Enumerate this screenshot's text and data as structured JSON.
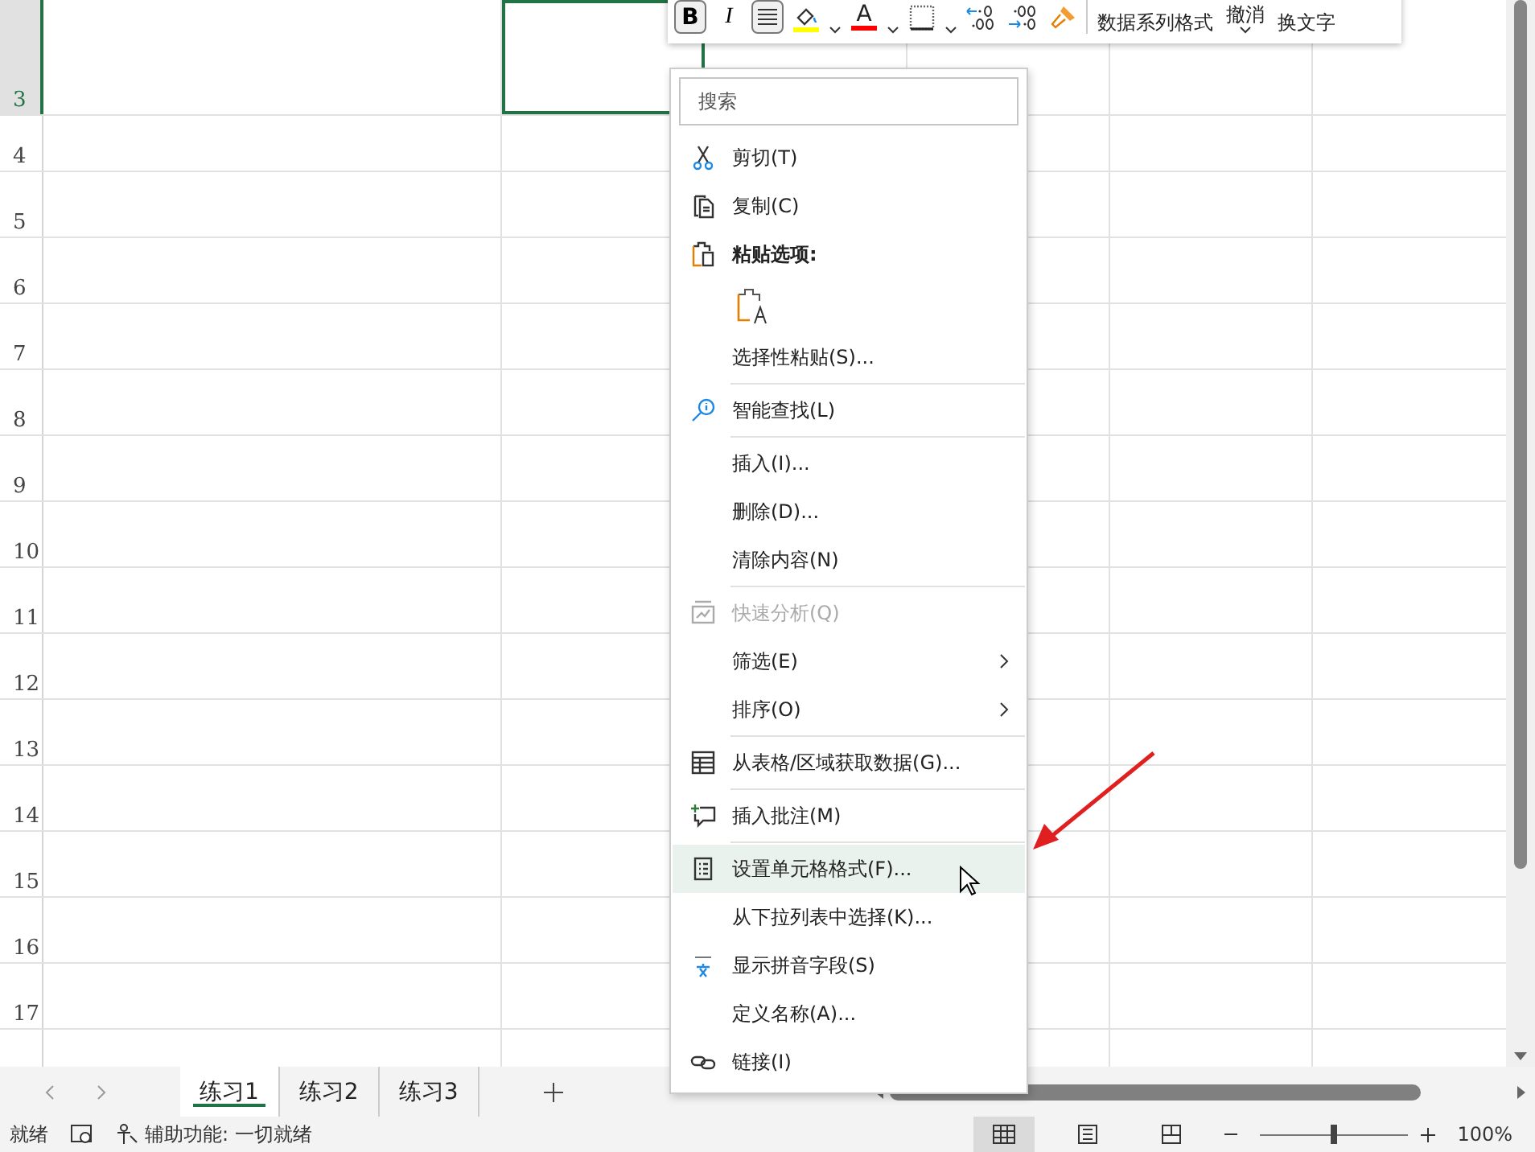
{
  "sheet": {
    "rows": [
      {
        "label": "3",
        "selected": true
      },
      {
        "label": "4",
        "selected": false
      },
      {
        "label": "5",
        "selected": false
      },
      {
        "label": "6",
        "selected": false
      },
      {
        "label": "7",
        "selected": false
      },
      {
        "label": "8",
        "selected": false
      },
      {
        "label": "9",
        "selected": false
      },
      {
        "label": "10",
        "selected": false
      },
      {
        "label": "11",
        "selected": false
      },
      {
        "label": "12",
        "selected": false
      },
      {
        "label": "13",
        "selected": false
      },
      {
        "label": "14",
        "selected": false
      },
      {
        "label": "15",
        "selected": false
      },
      {
        "label": "16",
        "selected": false
      },
      {
        "label": "17",
        "selected": false
      }
    ]
  },
  "mini_toolbar": {
    "buttons": [
      {
        "kind": "bold",
        "label": "B",
        "selected": true
      },
      {
        "kind": "italic",
        "label": "I",
        "selected": false
      },
      {
        "kind": "align",
        "selected": true
      },
      {
        "kind": "fill",
        "color": "#ffff00"
      },
      {
        "kind": "font-color",
        "label": "A",
        "color": "#ff0000"
      },
      {
        "kind": "border"
      },
      {
        "kind": "inc-decimal"
      },
      {
        "kind": "dec-decimal"
      },
      {
        "kind": "painter"
      }
    ],
    "text_buttons": [
      {
        "label": "数据系列格式",
        "caret": false
      },
      {
        "label": "撤消",
        "caret": true
      },
      {
        "label": "换文字",
        "caret": false
      }
    ]
  },
  "context_menu": {
    "search": {
      "placeholder": "搜索"
    },
    "items": [
      {
        "kind": "item",
        "label": "剪切(T)",
        "disabled": false,
        "hovered": false,
        "submenu": false
      },
      {
        "kind": "item",
        "label": "复制(C)",
        "disabled": false,
        "hovered": false,
        "submenu": false
      },
      {
        "kind": "header",
        "label": "粘贴选项:"
      },
      {
        "kind": "paste-option"
      },
      {
        "kind": "item",
        "label": "选择性粘贴(S)...",
        "disabled": false,
        "hovered": false,
        "submenu": false
      },
      {
        "kind": "separator"
      },
      {
        "kind": "item",
        "label": "智能查找(L)",
        "disabled": false,
        "hovered": false,
        "submenu": false
      },
      {
        "kind": "separator"
      },
      {
        "kind": "item",
        "label": "插入(I)...",
        "disabled": false,
        "hovered": false,
        "submenu": false
      },
      {
        "kind": "item",
        "label": "删除(D)...",
        "disabled": false,
        "hovered": false,
        "submenu": false
      },
      {
        "kind": "item",
        "label": "清除内容(N)",
        "disabled": false,
        "hovered": false,
        "submenu": false
      },
      {
        "kind": "separator"
      },
      {
        "kind": "item",
        "label": "快速分析(Q)",
        "disabled": true,
        "hovered": false,
        "submenu": false
      },
      {
        "kind": "item",
        "label": "筛选(E)",
        "disabled": false,
        "hovered": false,
        "submenu": true
      },
      {
        "kind": "item",
        "label": "排序(O)",
        "disabled": false,
        "hovered": false,
        "submenu": true
      },
      {
        "kind": "separator"
      },
      {
        "kind": "item",
        "label": "从表格/区域获取数据(G)...",
        "disabled": false,
        "hovered": false,
        "submenu": false
      },
      {
        "kind": "separator"
      },
      {
        "kind": "item",
        "label": "插入批注(M)",
        "disabled": false,
        "hovered": false,
        "submenu": false
      },
      {
        "kind": "separator"
      },
      {
        "kind": "item",
        "label": "设置单元格格式(F)...",
        "disabled": false,
        "hovered": true,
        "submenu": false
      },
      {
        "kind": "item",
        "label": "从下拉列表中选择(K)...",
        "disabled": false,
        "hovered": false,
        "submenu": false
      },
      {
        "kind": "item",
        "label": "显示拼音字段(S)",
        "disabled": false,
        "hovered": false,
        "submenu": false
      },
      {
        "kind": "item",
        "label": "定义名称(A)...",
        "disabled": false,
        "hovered": false,
        "submenu": false
      },
      {
        "kind": "item",
        "label": "链接(I)",
        "disabled": false,
        "hovered": false,
        "submenu": false
      }
    ]
  },
  "sheet_tabs": [
    {
      "label": "练习1",
      "selected": true
    },
    {
      "label": "练习2",
      "selected": false
    },
    {
      "label": "练习3",
      "selected": false
    }
  ],
  "status_bar": {
    "ready": "就绪",
    "accessibility": "辅助功能: 一切就绪",
    "views": [
      {
        "kind": "normal",
        "selected": true
      },
      {
        "kind": "page-layout",
        "selected": false
      },
      {
        "kind": "page-break",
        "selected": false
      }
    ],
    "zoom": {
      "level": 0.5,
      "reading": "100%"
    }
  }
}
